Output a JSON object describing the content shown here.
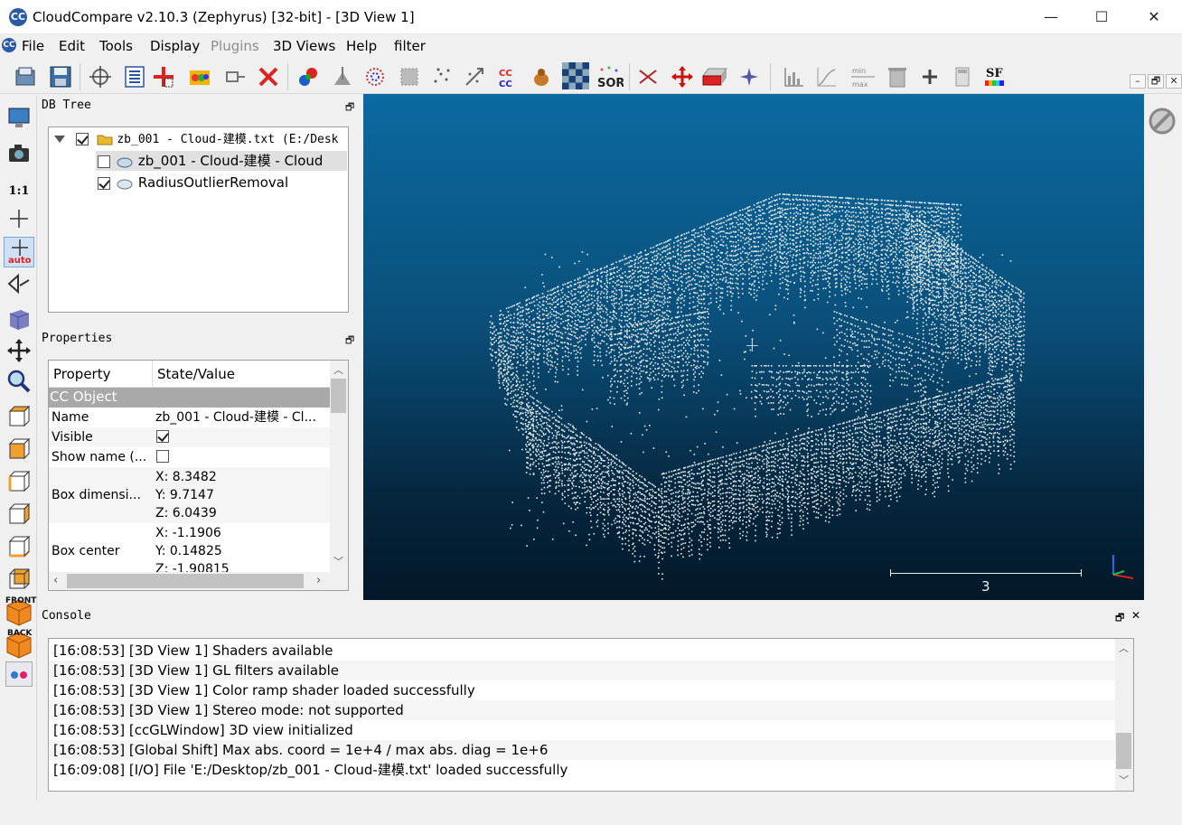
{
  "window": {
    "app_icon_text": "CC",
    "title": "CloudCompare v2.10.3 (Zephyrus) [32-bit] - [3D View 1]",
    "minimize": "—",
    "maximize": "☐",
    "close": "✕"
  },
  "menu": {
    "icon_text": "CC",
    "items": [
      "File",
      "Edit",
      "Tools",
      "Display",
      "Plugins",
      "3D Views",
      "Help",
      "filter"
    ],
    "mdi_controls": [
      "–",
      "🗗",
      "✕"
    ]
  },
  "toolbar": {
    "icons": [
      "open-icon",
      "save-icon",
      "pick-rotation-center-icon",
      "list-icon",
      "add-point-icon",
      "color-picker-icon",
      "clone-icon",
      "delete-icon",
      "merge-icon",
      "normals-icon",
      "sample-points-icon",
      "mesh-icon",
      "subsample-icon",
      "register-icon",
      "cc-icon",
      "dog-icon",
      "checkerboard-icon",
      "sor-icon",
      "cut-icon",
      "translate-icon",
      "plane-icon",
      "star-icon",
      "histogram-icon",
      "curve-icon",
      "min-max-icon",
      "trash-can-icon",
      "plus-icon",
      "calculator-icon",
      "sf-icon"
    ],
    "sor_label": "SOR",
    "sf_label": "SF",
    "cc_label": "CC\nCC",
    "min_max_label": "min max"
  },
  "left_toolbar": {
    "icons": [
      "monitor-icon",
      "camera-icon",
      "one-to-one-icon",
      "crosshair-icon",
      "auto-pick-icon",
      "perspective-icon",
      "cube-icon",
      "move-icon",
      "zoom-icon",
      "top-view-icon",
      "front-view-icon",
      "left-view-icon",
      "right-view-icon",
      "bottom-view-icon",
      "back-view-icon",
      "iso-front-icon",
      "iso-back-icon",
      "stereo-icon"
    ],
    "one_to_one": "1:1",
    "auto_label": "auto",
    "front_label": "FRONT",
    "back_label": "BACK"
  },
  "db_tree": {
    "title": "DB Tree",
    "float_icon": "🗗",
    "items": [
      {
        "label": "zb_001 - Cloud-建模.txt (E:/Desk",
        "checked": true
      },
      {
        "label": "zb_001 - Cloud-建模 - Cloud",
        "checked": false
      },
      {
        "label": "RadiusOutlierRemoval",
        "checked": true
      }
    ]
  },
  "properties": {
    "title": "Properties",
    "float_icon": "🗗",
    "col_property": "Property",
    "col_value": "State/Value",
    "section": "CC Object",
    "rows": {
      "name_label": "Name",
      "name_value": "zb_001 - Cloud-建模 - Cl...",
      "visible_label": "Visible",
      "show_name_label": "Show name (...",
      "box_dim_label": "Box dimensi...",
      "box_dim_x": "X: 8.3482",
      "box_dim_y": "Y: 9.7147",
      "box_dim_z": "Z: 6.0439",
      "box_center_label": "Box center",
      "box_center_x": "X: -1.1906",
      "box_center_y": "Y: 0.14825",
      "box_center_z": "Z: -1.90815"
    }
  },
  "viewport": {
    "scale_label": "3",
    "cursor": "+"
  },
  "console": {
    "title": "Console",
    "float_icon": "🗗",
    "close_icon": "✕",
    "lines": [
      "[16:08:53] [3D View 1] Shaders available",
      "[16:08:53] [3D View 1] GL filters available",
      "[16:08:53] [3D View 1] Color ramp shader loaded successfully",
      "[16:08:53] [3D View 1] Stereo mode: not supported",
      "[16:08:53] [ccGLWindow] 3D view initialized",
      "[16:08:53] [Global Shift] Max abs. coord = 1e+4 / max abs. diag = 1e+6",
      "[16:09:08] [I/O] File 'E:/Desktop/zb_001 - Cloud-建模.txt' loaded successfully"
    ]
  },
  "right_toolbar": {
    "icons": [
      "disable-icon"
    ]
  }
}
